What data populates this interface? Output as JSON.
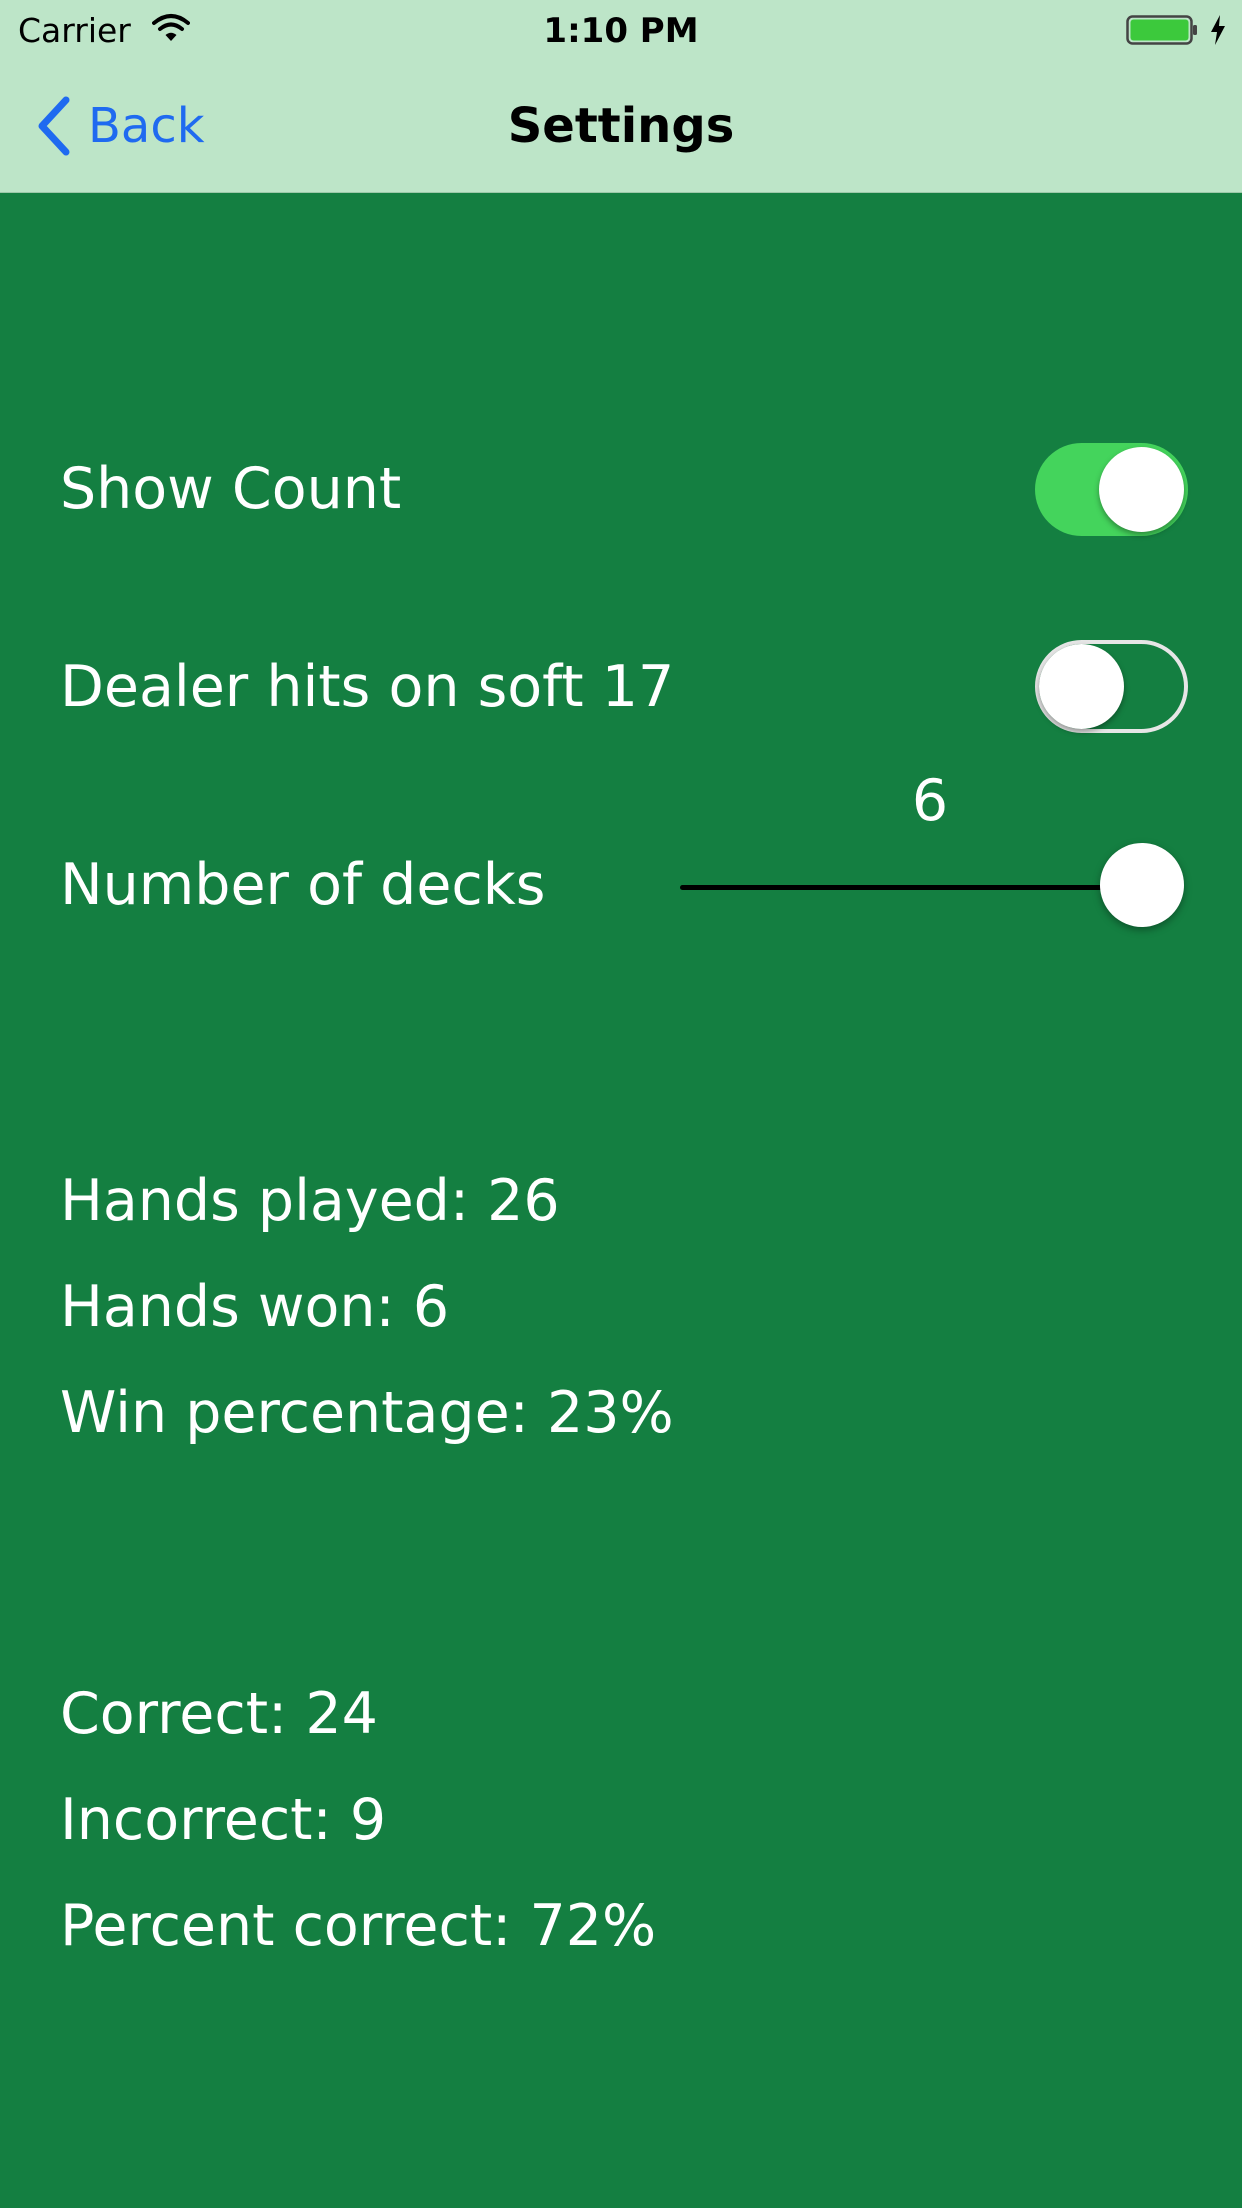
{
  "status_bar": {
    "carrier": "Carrier",
    "time": "1:10 PM",
    "battery_color": "#3cc93c"
  },
  "nav": {
    "back_label": "Back",
    "title": "Settings",
    "tint_color": "#1f6af0"
  },
  "colors": {
    "background": "#147f41",
    "nav_background": "#bde5c8",
    "toggle_on": "#44d45c"
  },
  "settings": {
    "show_count": {
      "label": "Show Count",
      "on": true
    },
    "dealer_hits_soft_17": {
      "label": "Dealer hits on soft 17",
      "on": false
    },
    "number_of_decks": {
      "label": "Number of decks",
      "value": "6",
      "slider_fraction": 1.0
    }
  },
  "stats": {
    "hands_played": "Hands played: 26",
    "hands_won": "Hands won: 6",
    "win_percentage": "Win percentage: 23%"
  },
  "accuracy": {
    "correct": "Correct: 24",
    "incorrect": "Incorrect: 9",
    "percent_correct": "Percent correct: 72%"
  }
}
